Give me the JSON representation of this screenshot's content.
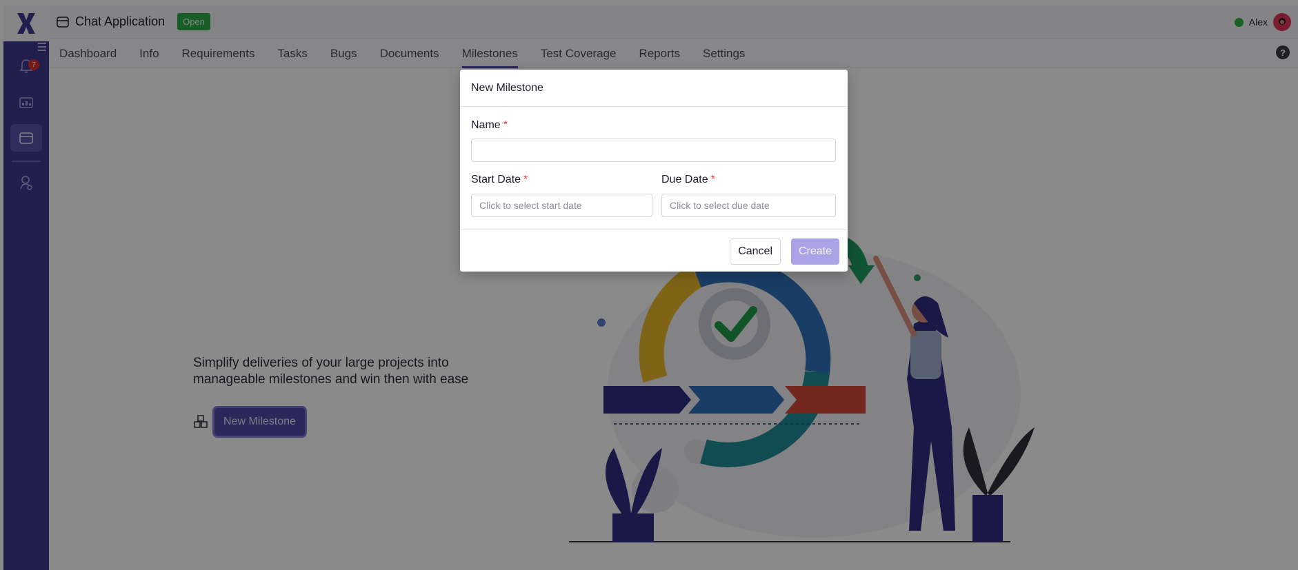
{
  "project": {
    "name": "Chat Application",
    "status": "Open"
  },
  "user": {
    "name": "Alex",
    "online_color": "#28b446"
  },
  "notifications": {
    "count": "7"
  },
  "nav": {
    "tabs": [
      "Dashboard",
      "Info",
      "Requirements",
      "Tasks",
      "Bugs",
      "Documents",
      "Milestones",
      "Test Coverage",
      "Reports",
      "Settings"
    ],
    "active": "Milestones",
    "help_icon": "?"
  },
  "empty_state": {
    "line1": "Simplify deliveries of your large projects into",
    "line2": "manageable milestones and win then with ease",
    "button_label": "New Milestone"
  },
  "modal": {
    "title": "New Milestone",
    "name_label": "Name",
    "start_date_label": "Start Date",
    "due_date_label": "Due Date",
    "required_marker": "*",
    "name_value": "",
    "start_date_placeholder": "Click to select start date",
    "due_date_placeholder": "Click to select due date",
    "cancel_label": "Cancel",
    "create_label": "Create"
  },
  "icons": {
    "logo": "x-logo-icon",
    "bell": "bell-icon",
    "dashboard": "dashboard-icon",
    "project": "project-box-icon",
    "users": "user-icon",
    "milestone": "milestone-cubes-icon",
    "help": "help-icon"
  },
  "colors": {
    "sidebar": "#3e3a8f",
    "accent": "#4f49a5",
    "status_open": "#2fa94a",
    "create_disabled": "#aaa4e6",
    "required": "#e03a3a"
  }
}
